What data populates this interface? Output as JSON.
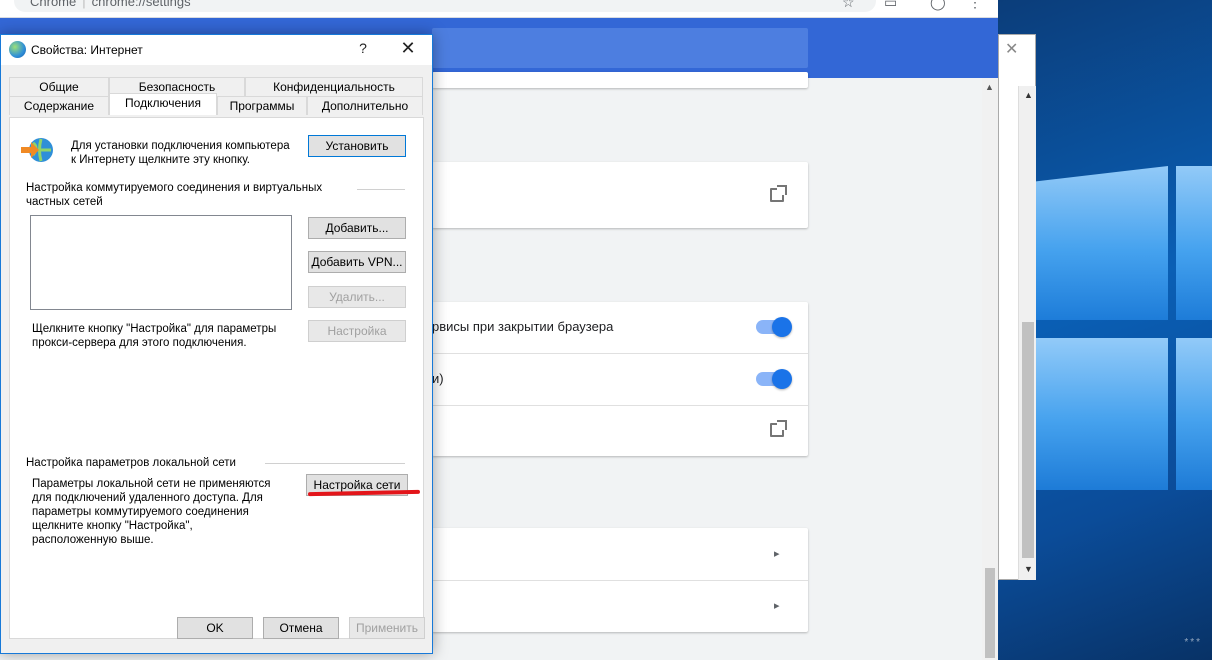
{
  "browser": {
    "tab_text": "Chrome",
    "url": "chrome://settings"
  },
  "settings": {
    "row_close_text": "рвисы при закрытии браузера",
    "row_second_text": "и)"
  },
  "dialog": {
    "title": "Свойства: Интернет",
    "help": "?",
    "close": "✕",
    "tabs_row1": [
      "Общие",
      "Безопасность",
      "Конфиденциальность"
    ],
    "tabs_row2": [
      "Содержание",
      "Подключения",
      "Программы",
      "Дополнительно"
    ],
    "active_tab": "Подключения",
    "setup_text": "Для установки подключения компьютера к Интернету щелкните эту кнопку.",
    "setup_line1": "Для установки подключения компьютера",
    "setup_line2": "к Интернету щелкните эту кнопку.",
    "setup_button": "Установить",
    "dialup_group_line1": "Настройка коммутируемого соединения и виртуальных",
    "dialup_group_line2": "частных сетей",
    "add_button": "Добавить...",
    "add_vpn_button": "Добавить VPN...",
    "remove_button": "Удалить...",
    "settings_button": "Настройка",
    "proxy_hint_line1": "Щелкните кнопку \"Настройка\" для параметры",
    "proxy_hint_line2": "прокси-сервера для этого подключения.",
    "lan_group": "Настройка параметров локальной сети",
    "lan_text_line1": "Параметры локальной сети не применяются",
    "lan_text_line2": "для подключений удаленного доступа. Для",
    "lan_text_line3": "параметры коммутируемого соединения",
    "lan_text_line4": "щелкните кнопку \"Настройка\",",
    "lan_text_line5": "расположенную выше.",
    "lan_settings_button": "Настройка сети",
    "ok_button": "OK",
    "cancel_button": "Отмена",
    "apply_button": "Применить"
  },
  "desktop": {
    "watermark": "***"
  },
  "colors": {
    "chrome_header": "#3367d6",
    "toggle_on": "#1a73e8",
    "annotation_red": "#e3151a"
  }
}
